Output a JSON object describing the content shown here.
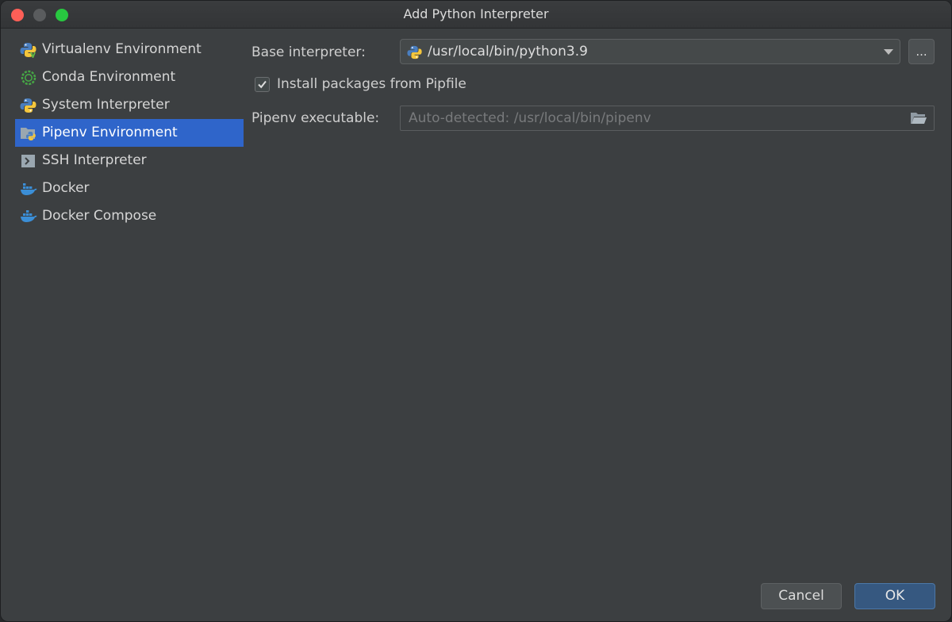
{
  "window": {
    "title": "Add Python Interpreter"
  },
  "sidebar": {
    "items": [
      {
        "label": "Virtualenv Environment",
        "icon": "virtualenv-icon"
      },
      {
        "label": "Conda Environment",
        "icon": "conda-icon"
      },
      {
        "label": "System Interpreter",
        "icon": "python-icon"
      },
      {
        "label": "Pipenv Environment",
        "icon": "pipenv-icon",
        "selected": true
      },
      {
        "label": "SSH Interpreter",
        "icon": "terminal-icon"
      },
      {
        "label": "Docker",
        "icon": "docker-icon"
      },
      {
        "label": "Docker Compose",
        "icon": "docker-compose-icon"
      }
    ]
  },
  "form": {
    "base_interpreter_label": "Base interpreter:",
    "base_interpreter_value": "/usr/local/bin/python3.9",
    "browse_label": "...",
    "install_checkbox_label": "Install packages from Pipfile",
    "install_checked": true,
    "pipenv_label": "Pipenv executable:",
    "pipenv_placeholder": "Auto-detected: /usr/local/bin/pipenv"
  },
  "buttons": {
    "cancel": "Cancel",
    "ok": "OK"
  },
  "colors": {
    "selection": "#2f65ca",
    "ok_button": "#365880",
    "background": "#3c3f41"
  }
}
